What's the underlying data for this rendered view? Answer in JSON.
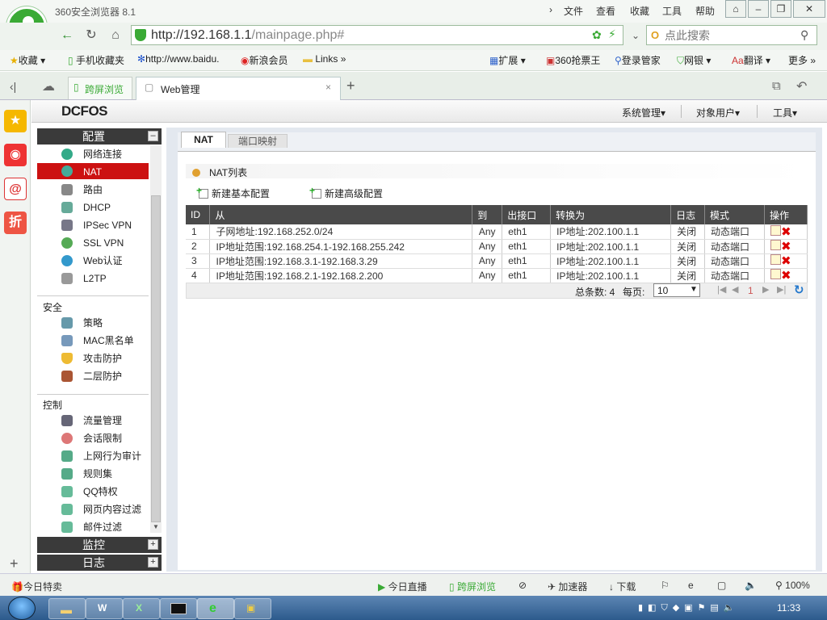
{
  "browser": {
    "app_title": "360安全浏览器 8.1",
    "menu": [
      "文件",
      "查看",
      "收藏",
      "工具",
      "帮助"
    ],
    "url_host": "http://192.168.1.1",
    "url_path": "/mainpage.php#",
    "search_placeholder": "点此搜索",
    "bookmarks": [
      "收藏",
      "手机收藏夹",
      "http://www.baidu.",
      "新浪会员",
      "Links"
    ],
    "bookmarks_right": [
      "扩展",
      "360抢票王",
      "登录管家",
      "网银",
      "翻译",
      "更多"
    ],
    "tabs": [
      {
        "label": "跨屏浏览"
      },
      {
        "label": "Web管理"
      }
    ]
  },
  "app": {
    "brand": "DCFOS",
    "top_menu": [
      "系统管理",
      "对象用户",
      "工具"
    ],
    "sidebar": {
      "config_header": "配置",
      "config_items": [
        "网络连接",
        "NAT",
        "路由",
        "DHCP",
        "IPSec VPN",
        "SSL VPN",
        "Web认证",
        "L2TP"
      ],
      "security_header": "安全",
      "security_items": [
        "策略",
        "MAC黑名单",
        "攻击防护",
        "二层防护"
      ],
      "control_header": "控制",
      "control_items": [
        "流量管理",
        "会话限制",
        "上网行为审计",
        "规则集",
        "QQ特权",
        "网页内容过滤",
        "邮件过滤"
      ],
      "monitor_header": "监控",
      "log_header": "日志"
    },
    "tabs": [
      "NAT",
      "端口映射"
    ],
    "list_title": "NAT列表",
    "actions": [
      "新建基本配置",
      "新建高级配置"
    ],
    "table": {
      "columns": [
        "ID",
        "从",
        "到",
        "出接口",
        "转换为",
        "日志",
        "模式",
        "操作"
      ],
      "rows": [
        [
          "1",
          "子网地址:192.168.252.0/24",
          "Any",
          "eth1",
          "IP地址:202.100.1.1",
          "关闭",
          "动态端口"
        ],
        [
          "2",
          "IP地址范围:192.168.254.1-192.168.255.242",
          "Any",
          "eth1",
          "IP地址:202.100.1.1",
          "关闭",
          "动态端口"
        ],
        [
          "3",
          "IP地址范围:192.168.3.1-192.168.3.29",
          "Any",
          "eth1",
          "IP地址:202.100.1.1",
          "关闭",
          "动态端口"
        ],
        [
          "4",
          "IP地址范围:192.168.2.1-192.168.2.200",
          "Any",
          "eth1",
          "IP地址:202.100.1.1",
          "关闭",
          "动态端口"
        ]
      ]
    },
    "pager": {
      "total_label": "总条数: 4",
      "per_page_label": "每页:",
      "per_page": "10",
      "page": "1"
    }
  },
  "statusbar": {
    "left": "今日特卖",
    "items": [
      "今日直播",
      "跨屏浏览",
      "加速器",
      "下载"
    ],
    "zoom": "100%"
  },
  "taskbar": {
    "clock": "11:33"
  },
  "colors": {
    "accent_red": "#cc1111",
    "header_dark": "#3a3a3a",
    "browser_green": "#3aaa35"
  }
}
